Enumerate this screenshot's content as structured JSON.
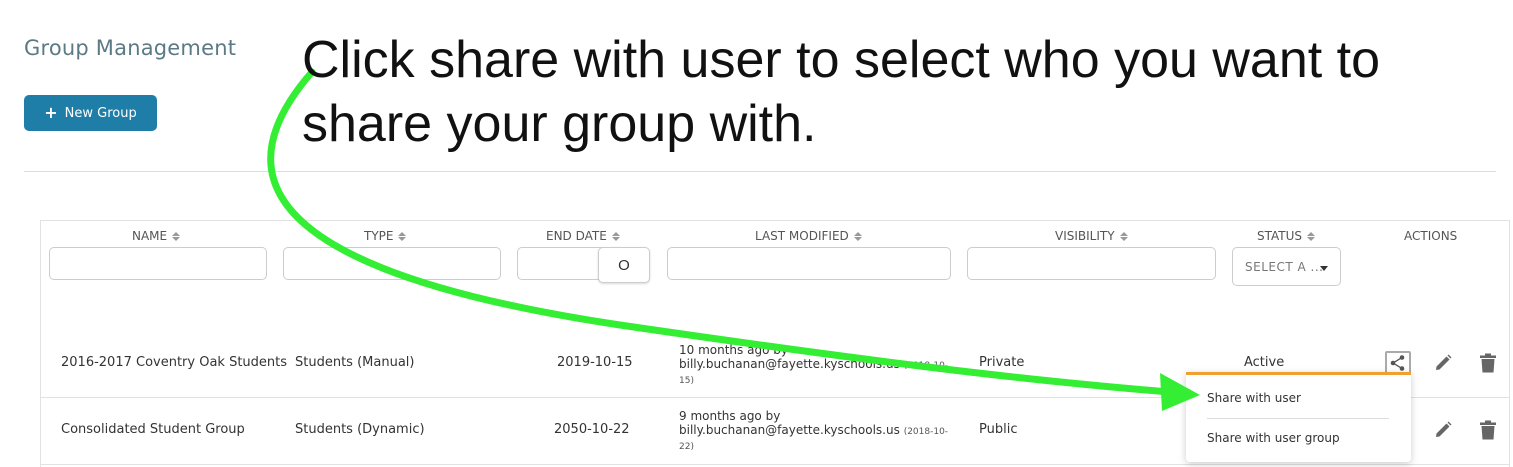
{
  "page": {
    "title": "Group Management",
    "new_group_label": "New Group"
  },
  "table": {
    "columns": [
      "NAME",
      "TYPE",
      "END DATE",
      "LAST MODIFIED",
      "VISIBILITY",
      "STATUS",
      "ACTIONS"
    ],
    "date_picker_glyph": "O",
    "status_filter_value": "SELECT A ...",
    "rows": [
      {
        "name": "2016-2017 Coventry Oak Students",
        "type": "Students (Manual)",
        "end_date": "2019-10-15",
        "modified_ago": "10 months ago by",
        "modified_by": "billy.buchanan@fayette.kyschools.us",
        "modified_date_a": "(2018-10-",
        "modified_date_b": "15)",
        "visibility": "Private",
        "status": "Active"
      },
      {
        "name": "Consolidated Student Group",
        "type": "Students (Dynamic)",
        "end_date": "2050-10-22",
        "modified_ago": "9 months ago by",
        "modified_by": "billy.buchanan@fayette.kyschools.us",
        "modified_date_a": "(2018-10-",
        "modified_date_b": "22)",
        "visibility": "Public",
        "status": ""
      }
    ]
  },
  "share_menu": {
    "items": [
      "Share with user",
      "Share with user group"
    ]
  },
  "annotation": {
    "text": "Click share with user to select who you want to share your group with.",
    "arrow_color": "#33ee33"
  },
  "colors": {
    "primary_button": "#1f7ea8",
    "title": "#5b7a85",
    "menu_accent": "#f0a030"
  }
}
